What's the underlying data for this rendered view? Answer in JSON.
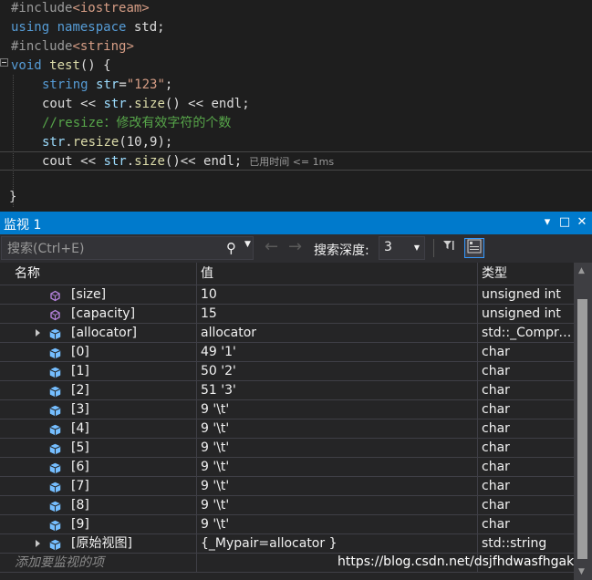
{
  "editor": {
    "lines": [
      {
        "pp": "#include",
        "rest": "<iostream>"
      },
      {
        "kw1": "using",
        "kw2": "namespace",
        "rest": " std;"
      },
      {
        "pp": "#include",
        "rest": "<string>"
      },
      {
        "kw": "void",
        "fn": "test",
        "rest": "() {"
      },
      {
        "ty": "string",
        "var": "str",
        "str": "\"123\"",
        "rest": ";"
      },
      {
        "a": "cout",
        "b": "str",
        "fn": "size",
        "c": "endl"
      },
      {
        "cm": "//resize：修改有效字符的个数"
      },
      {
        "var": "str",
        "fn": "resize",
        "args": "(10,9);"
      },
      {
        "a": "cout",
        "b": "str",
        "fn": "size",
        "c": "endl",
        "elapsed": "已用时间 <= 1ms"
      },
      {
        "rest": "}"
      }
    ]
  },
  "watch": {
    "title": "监视 1",
    "search_placeholder": "搜索(Ctrl+E)",
    "depth_label": "搜索深度:",
    "depth_value": "3",
    "columns": {
      "name": "名称",
      "value": "值",
      "type": "类型"
    },
    "rows": [
      {
        "name": "[size]",
        "value": "10",
        "type": "unsigned int",
        "icon": "property-icon",
        "expandable": false
      },
      {
        "name": "[capacity]",
        "value": "15",
        "type": "unsigned int",
        "icon": "property-icon",
        "expandable": false
      },
      {
        "name": "[allocator]",
        "value": "allocator",
        "type": "std::_Compre…",
        "icon": "field-icon",
        "expandable": true
      },
      {
        "name": "[0]",
        "value": "49 '1'",
        "type": "char",
        "icon": "field-icon",
        "expandable": false
      },
      {
        "name": "[1]",
        "value": "50 '2'",
        "type": "char",
        "icon": "field-icon",
        "expandable": false
      },
      {
        "name": "[2]",
        "value": "51 '3'",
        "type": "char",
        "icon": "field-icon",
        "expandable": false
      },
      {
        "name": "[3]",
        "value": "9 '\\t'",
        "type": "char",
        "icon": "field-icon",
        "expandable": false
      },
      {
        "name": "[4]",
        "value": "9 '\\t'",
        "type": "char",
        "icon": "field-icon",
        "expandable": false
      },
      {
        "name": "[5]",
        "value": "9 '\\t'",
        "type": "char",
        "icon": "field-icon",
        "expandable": false
      },
      {
        "name": "[6]",
        "value": "9 '\\t'",
        "type": "char",
        "icon": "field-icon",
        "expandable": false
      },
      {
        "name": "[7]",
        "value": "9 '\\t'",
        "type": "char",
        "icon": "field-icon",
        "expandable": false
      },
      {
        "name": "[8]",
        "value": "9 '\\t'",
        "type": "char",
        "icon": "field-icon",
        "expandable": false
      },
      {
        "name": "[9]",
        "value": "9 '\\t'",
        "type": "char",
        "icon": "field-icon",
        "expandable": false
      },
      {
        "name": "[原始视图]",
        "value": "{_Mypair=allocator }",
        "type": "std::string",
        "icon": "field-icon",
        "expandable": true
      }
    ],
    "add_item": "添加要监视的项",
    "watermark": "https://blog.csdn.net/dsjfhdwasfhgakjs"
  },
  "colors": {
    "accent": "#007acc",
    "property_icon": "#b180d7",
    "field_icon": "#75beff"
  }
}
